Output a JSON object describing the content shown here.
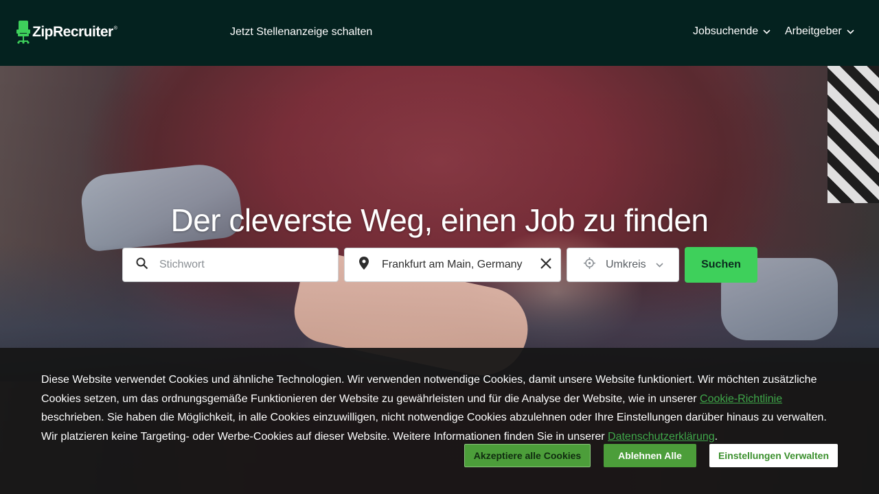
{
  "header": {
    "logo_text": "ZipRecruiter",
    "logo_tm": "®",
    "post_job_label": "Jetzt Stellenanzeige schalten",
    "nav": [
      {
        "label": "Jobsuchende",
        "icon": "chevron-down-icon"
      },
      {
        "label": "Arbeitgeber",
        "icon": "chevron-down-icon"
      }
    ]
  },
  "hero": {
    "headline": "Der cleverste Weg, einen Job zu finden"
  },
  "search": {
    "keyword_placeholder": "Stichwort",
    "keyword_value": "",
    "location_value": "Frankfurt am Main, Germany",
    "radius_label": "Umkreis",
    "submit_label": "Suchen",
    "icons": {
      "keyword": "search-icon",
      "location": "location-pin-icon",
      "clear": "close-icon",
      "radius": "crosshair-icon",
      "radius_dropdown": "chevron-down-icon"
    }
  },
  "cookie_banner": {
    "text_part1": "Diese Website verwendet Cookies und ähnliche Technologien. Wir verwenden notwendige Cookies, damit unsere Website funktioniert. Wir möchten zusätzliche Cookies setzen, um das ordnungsgemäße Funktionieren der Website zu gewährleisten und für die Analyse der Website, wie in unserer ",
    "cookie_policy_link": "Cookie-Richtlinie",
    "text_part2": " beschrieben. Sie haben die Möglichkeit, in alle Cookies einzuwilligen, nicht notwendige Cookies abzulehnen oder Ihre Einstellungen darüber hinaus zu verwalten. Wir platzieren keine Targeting- oder Werbe-Cookies auf dieser Website. Weitere Informationen finden Sie in unserer ",
    "privacy_link": "Datenschutzerklärung",
    "text_part3": ".",
    "accept_label": "Akzeptiere alle Cookies",
    "reject_label": "Ablehnen Alle",
    "settings_label": "Einstellungen Verwalten"
  },
  "colors": {
    "header_bg": "#04221f",
    "brand_green": "#3ed05b",
    "cookie_button_green": "#4c9e3a",
    "link_green": "#3fa84a"
  }
}
